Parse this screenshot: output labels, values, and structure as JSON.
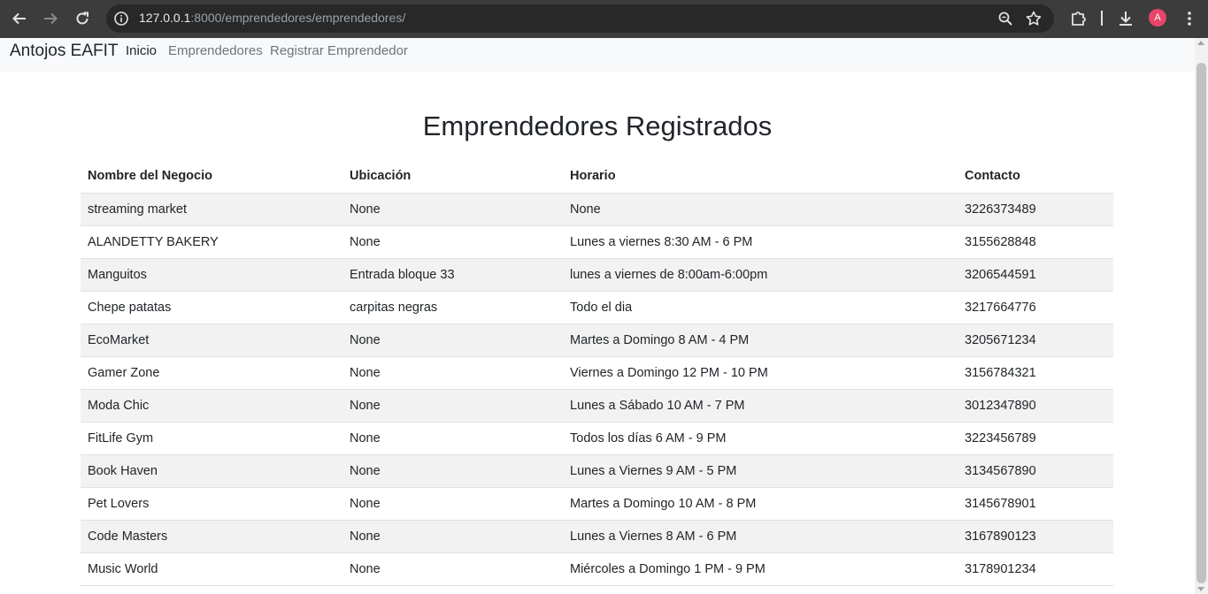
{
  "browser": {
    "url_host": "127.0.0.1",
    "url_path": ":8000/emprendedores/emprendedores/",
    "profile_initial": "A",
    "icons": [
      "back-icon",
      "forward-icon",
      "reload-icon",
      "site-info-icon",
      "zoom-icon",
      "bookmark-star-icon",
      "extensions-icon",
      "download-icon",
      "menu-kebab-icon"
    ]
  },
  "navbar": {
    "brand": "Antojos EAFIT",
    "links": [
      {
        "label": "Inicio",
        "active": true
      },
      {
        "label": "Emprendedores",
        "active": false
      },
      {
        "label": "Registrar Emprendedor",
        "active": false
      }
    ]
  },
  "main": {
    "title": "Emprendedores Registrados",
    "table": {
      "headers": [
        "Nombre del Negocio",
        "Ubicación",
        "Horario",
        "Contacto"
      ],
      "rows": [
        [
          "streaming market",
          "None",
          "None",
          "3226373489"
        ],
        [
          "ALANDETTY BAKERY",
          "None",
          "Lunes a viernes 8:30 AM - 6 PM",
          "3155628848"
        ],
        [
          "Manguitos",
          "Entrada bloque 33",
          "lunes a viernes de 8:00am-6:00pm",
          "3206544591"
        ],
        [
          "Chepe patatas",
          "carpitas negras",
          "Todo el dia",
          "3217664776"
        ],
        [
          "EcoMarket",
          "None",
          "Martes a Domingo 8 AM - 4 PM",
          "3205671234"
        ],
        [
          "Gamer Zone",
          "None",
          "Viernes a Domingo 12 PM - 10 PM",
          "3156784321"
        ],
        [
          "Moda Chic",
          "None",
          "Lunes a Sábado 10 AM - 7 PM",
          "3012347890"
        ],
        [
          "FitLife Gym",
          "None",
          "Todos los días 6 AM - 9 PM",
          "3223456789"
        ],
        [
          "Book Haven",
          "None",
          "Lunes a Viernes 9 AM - 5 PM",
          "3134567890"
        ],
        [
          "Pet Lovers",
          "None",
          "Martes a Domingo 10 AM - 8 PM",
          "3145678901"
        ],
        [
          "Code Masters",
          "None",
          "Lunes a Viernes 8 AM - 6 PM",
          "3167890123"
        ],
        [
          "Music World",
          "None",
          "Miércoles a Domingo 1 PM - 9 PM",
          "3178901234"
        ]
      ]
    }
  },
  "colors": {
    "chrome_bg": "#3c3c3c",
    "omnibox_bg": "#282828",
    "navbar_bg": "#f8f9fa",
    "stripe_bg": "#f2f2f2",
    "text": "#212529",
    "muted": "#6c757d",
    "avatar": "#e8456b"
  }
}
